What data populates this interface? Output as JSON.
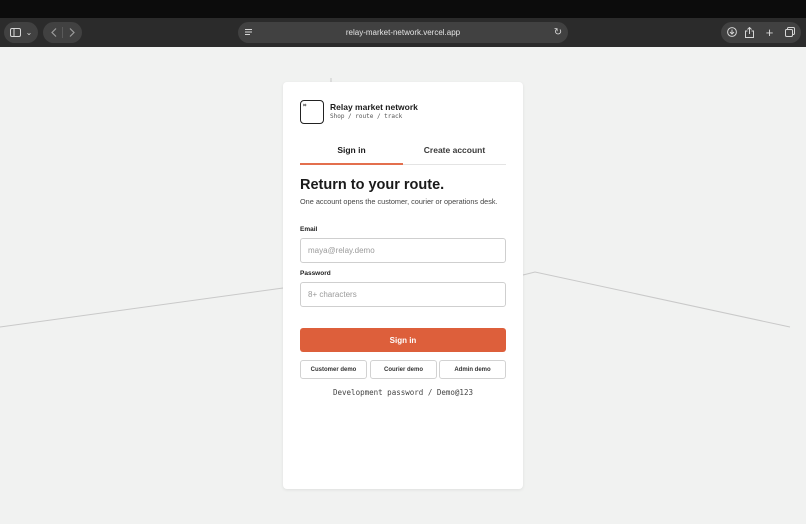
{
  "browser": {
    "url": "relay-market-network.vercel.app",
    "icons": {
      "sidebar": "sidebar-icon",
      "back": "chevron-left-icon",
      "forward": "chevron-right-icon",
      "reader": "reader-icon",
      "reload": "reload-icon",
      "download": "download-icon",
      "share": "share-icon",
      "new_tab": "plus-icon",
      "tabs": "tabs-overview-icon"
    }
  },
  "brand": {
    "name": "Relay market network",
    "tagline": "Shop / route / track",
    "logo_glyph": "⌗"
  },
  "tabs": [
    {
      "label": "Sign in",
      "active": true
    },
    {
      "label": "Create account",
      "active": false
    }
  ],
  "form": {
    "heading": "Return to your route.",
    "description": "One account opens the customer, courier or operations desk.",
    "email_label": "Email",
    "email_placeholder": "maya@relay.demo",
    "email_value": "",
    "password_label": "Password",
    "password_placeholder": "8+ characters",
    "password_value": "",
    "submit_label": "Sign in"
  },
  "demo_buttons": [
    {
      "label": "Customer demo"
    },
    {
      "label": "Courier demo"
    },
    {
      "label": "Admin demo"
    }
  ],
  "dev_note": "Development password / Demo@123",
  "colors": {
    "accent": "#dd5f3b",
    "tab_underline": "#e36f4e",
    "page_bg": "#f1f2f1",
    "toolbar_bg": "#2b2b2b"
  }
}
